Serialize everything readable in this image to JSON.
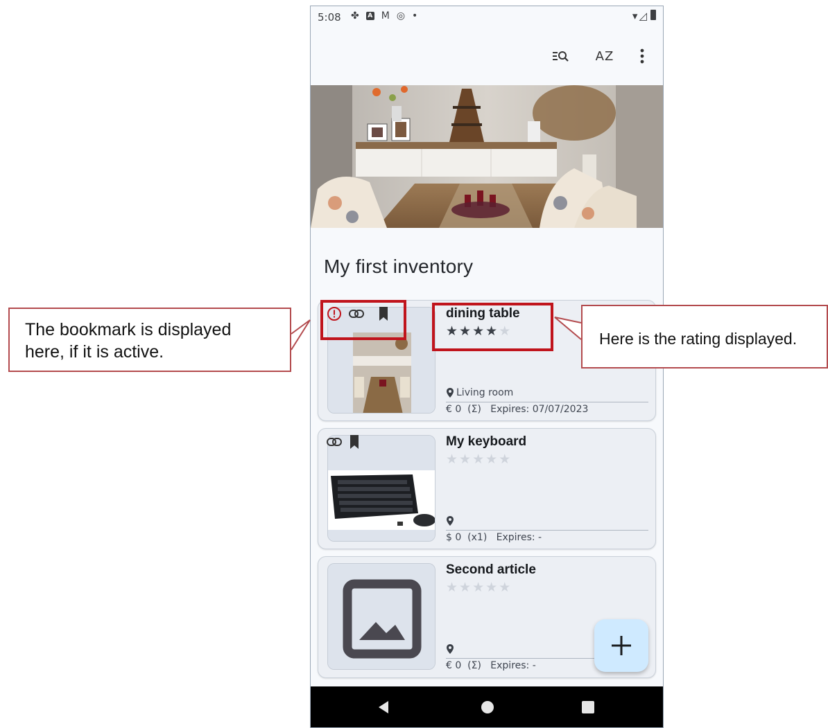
{
  "status_bar": {
    "time": "5:08"
  },
  "toolbar": {
    "filter_icon": "filter-search-icon",
    "sort_icon": "sort-az-icon",
    "sort_label": "AZ",
    "menu_icon": "more-vert-icon"
  },
  "inventory": {
    "title": "My first inventory",
    "items": [
      {
        "name": "dining table",
        "rating": 4,
        "max_rating": 5,
        "location": "Living room",
        "meta": "€ 0  (Σ)   Expires: 07/07/2023",
        "icons": [
          "warning-icon",
          "link-icon",
          "bookmark-icon"
        ]
      },
      {
        "name": "My keyboard",
        "rating": 0,
        "max_rating": 5,
        "location": "",
        "meta": "$ 0  (x1)   Expires: -",
        "icons": [
          "link-icon",
          "bookmark-icon"
        ]
      },
      {
        "name": "Second article",
        "rating": 0,
        "max_rating": 5,
        "location": "",
        "meta": "€ 0  (Σ)   Expires: -",
        "icons": []
      }
    ]
  },
  "fab": {
    "icon": "add-icon"
  },
  "annotations": {
    "left": "The bookmark is displayed here, if it is active.",
    "right": "Here is the rating displayed."
  },
  "colors": {
    "highlight": "#c0141c",
    "fab": "#cfeaff",
    "card": "#eceff4",
    "background": "#f7f9fc"
  }
}
